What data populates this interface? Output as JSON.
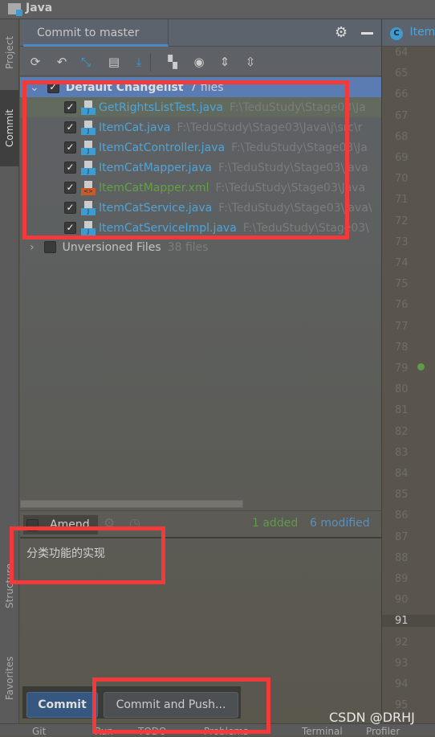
{
  "window": {
    "title": "Java"
  },
  "left_strip": {
    "tabs": [
      "Project",
      "Commit",
      "Structure",
      "Favorites"
    ]
  },
  "commit_panel": {
    "tab_label": "Commit to master",
    "toolbar_icons": [
      "refresh-icon",
      "rollback-icon",
      "diff-icon",
      "changelist-icon",
      "update-icon",
      "group-by-icon",
      "view-options-icon",
      "expand-all-icon",
      "collapse-all-icon"
    ],
    "changelist": {
      "name": "Default Changelist",
      "count": "7 files"
    },
    "files": [
      {
        "name": "GetRightsListTest.java",
        "path": "F:\\TeduStudy\\Stage03\\Ja",
        "type": "java",
        "status": "modified"
      },
      {
        "name": "ItemCat.java",
        "path": "F:\\TeduStudy\\Stage03\\Java\\j\\src\\r",
        "type": "java",
        "status": "modified"
      },
      {
        "name": "ItemCatController.java",
        "path": "F:\\TeduStudy\\Stage03\\Ja",
        "type": "java",
        "status": "modified"
      },
      {
        "name": "ItemCatMapper.java",
        "path": "F:\\TeduStudy\\Stage03\\Java",
        "type": "java",
        "status": "modified"
      },
      {
        "name": "ItemCatMapper.xml",
        "path": "F:\\TeduStudy\\Stage03\\Java",
        "type": "xml",
        "status": "added"
      },
      {
        "name": "ItemCatService.java",
        "path": "F:\\TeduStudy\\Stage03\\Java\\",
        "type": "java",
        "status": "modified"
      },
      {
        "name": "ItemCatServiceImpl.java",
        "path": "F:\\TeduStudy\\Stage03\\",
        "type": "java",
        "status": "modified"
      }
    ],
    "unversioned": {
      "name": "Unversioned Files",
      "count": "38 files"
    },
    "amend_label": "Amend",
    "stats": {
      "added": "1 added",
      "modified": "6 modified"
    },
    "message": "分类功能的实现",
    "commit_button": "Commit",
    "commit_push_button": "Commit and Push..."
  },
  "editor": {
    "tab": "Item",
    "line_numbers": [
      "64",
      "65",
      "66",
      "67",
      "68",
      "69",
      "70",
      "71",
      "72",
      "73",
      "74",
      "75",
      "76",
      "77",
      "78",
      "79",
      "80",
      "81",
      "82",
      "83",
      "84",
      "85",
      "86",
      "87",
      "88",
      "89",
      "90",
      "91",
      "92",
      "93",
      "94",
      "95"
    ],
    "current_line": "91"
  },
  "bottom_bar": [
    "Git",
    "Run",
    "TODO",
    "Problems",
    "Terminal",
    "Profiler"
  ],
  "watermark": "CSDN @DRHJ",
  "colors": {
    "accent": "#4a88c7",
    "java_file": "#4ea4d8",
    "added_file": "#62a044",
    "highlight": "#f23a3a"
  }
}
